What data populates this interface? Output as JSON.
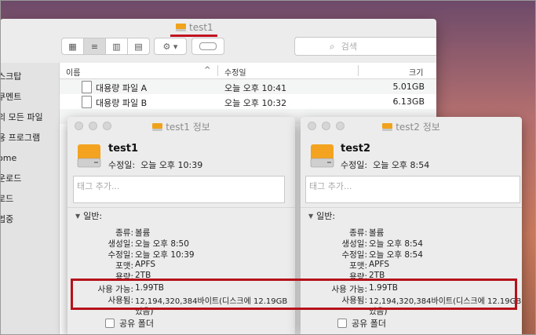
{
  "finder": {
    "title": "test1",
    "search_placeholder": "검색",
    "sidebar": [
      "스크탑",
      "쿠멘트",
      "의 모든 파일",
      "용 프로그램",
      "ome",
      "운로드",
      "로드",
      "법중"
    ],
    "columns": {
      "name": "이름",
      "modified": "수정일",
      "size": "크기"
    },
    "files": [
      {
        "name": "대용량 파일 A",
        "modified": "오늘 오후 10:41",
        "size": "5.01GB"
      },
      {
        "name": "대용량 파일 B",
        "modified": "오늘 오후 10:32",
        "size": "6.13GB"
      }
    ]
  },
  "info1": {
    "window_title": "test1 정보",
    "name": "test1",
    "modified_label": "수정일:",
    "modified_value": "오늘 오후 10:39",
    "tag_placeholder": "태그 추가...",
    "section": "일반:",
    "fields": [
      {
        "k": "종류:",
        "v": "볼륨"
      },
      {
        "k": "생성일:",
        "v": "오늘 오후 8:50"
      },
      {
        "k": "수정일:",
        "v": "오늘 오후 10:39"
      },
      {
        "k": "포맷:",
        "v": "APFS"
      },
      {
        "k": "용량:",
        "v": "2TB"
      },
      {
        "k": "사용 가능:",
        "v": "1.99TB"
      },
      {
        "k": "사용됨:",
        "v": "12,194,320,384바이트(디스크에 12.19GB"
      },
      {
        "k": "",
        "v": "있음)"
      }
    ],
    "shared_folder": "공유 폴더"
  },
  "info2": {
    "window_title": "test2 정보",
    "name": "test2",
    "modified_label": "수정일:",
    "modified_value": "오늘 오후 8:54",
    "tag_placeholder": "태그 추가...",
    "section": "일반:",
    "fields": [
      {
        "k": "종류:",
        "v": "볼륨"
      },
      {
        "k": "생성일:",
        "v": "오늘 오후 8:54"
      },
      {
        "k": "수정일:",
        "v": "오늘 오후 8:54"
      },
      {
        "k": "포맷:",
        "v": "APFS"
      },
      {
        "k": "용량:",
        "v": "2TB"
      },
      {
        "k": "사용 가능:",
        "v": "1.99TB"
      },
      {
        "k": "사용됨:",
        "v": "12,194,320,384바이트(디스크에 12.19GB"
      },
      {
        "k": "",
        "v": "있음)"
      }
    ],
    "shared_folder": "공유 폴더"
  },
  "colors": {
    "accent_red": "#b5121b",
    "drive_orange": "#f0a21b"
  }
}
